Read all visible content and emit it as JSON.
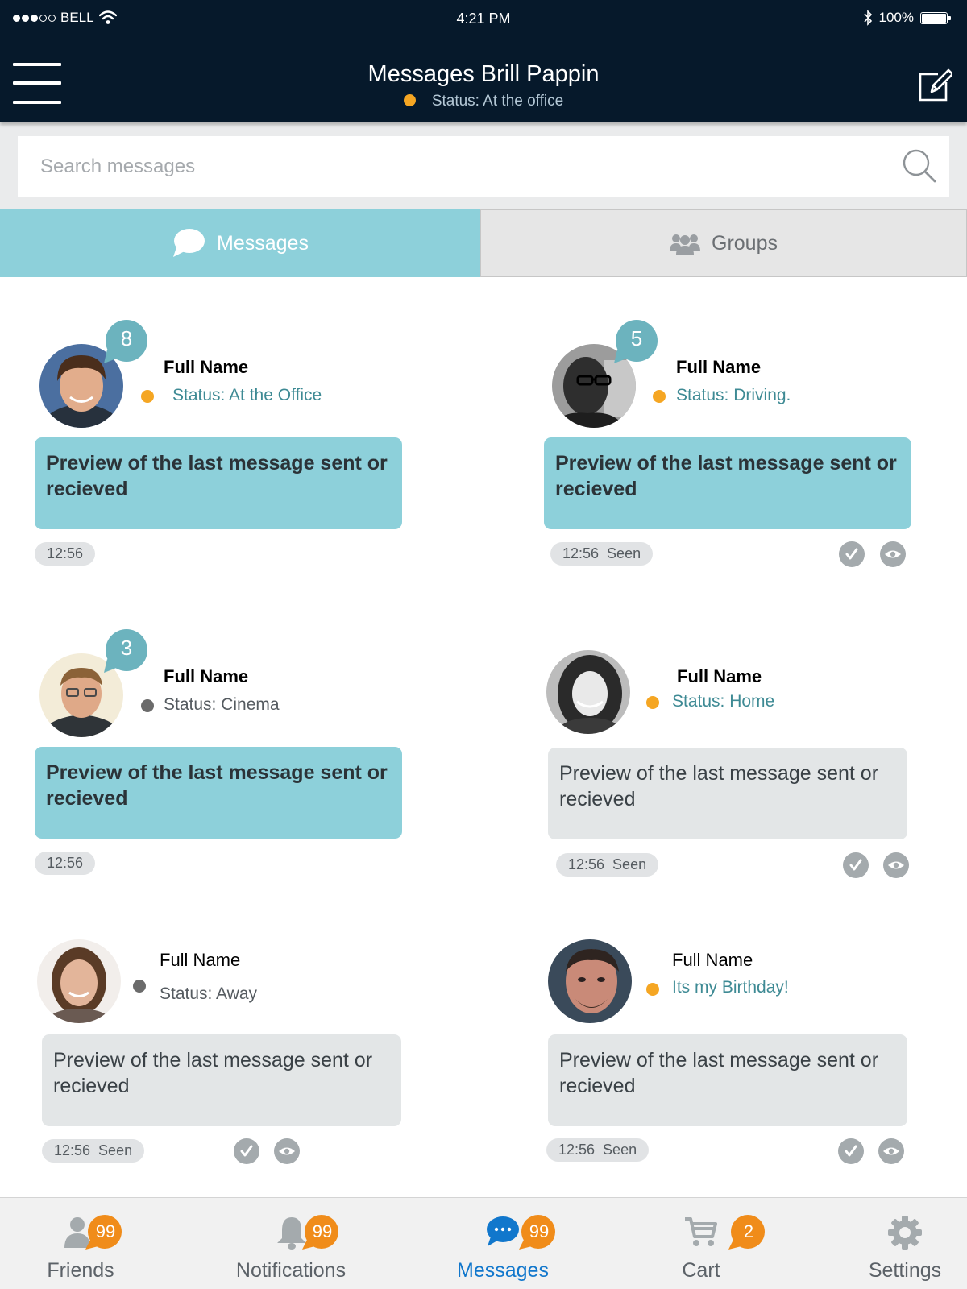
{
  "status_bar": {
    "carrier": "BELL",
    "time": "4:21 PM",
    "battery": "100%"
  },
  "header": {
    "title": "Messages Brill Pappin",
    "status": "Status: At the office"
  },
  "search": {
    "placeholder": "Search messages"
  },
  "tabs": [
    {
      "label": "Messages",
      "selected": true
    },
    {
      "label": "Groups",
      "selected": false
    }
  ],
  "colors": {
    "header_bg": "#06192b",
    "accent_teal": "#8dd0da",
    "status_available": "#f5a623",
    "status_away": "#6b6b6b",
    "active_nav": "#1177cc",
    "badge_orange": "#f08c1a"
  },
  "conversations": [
    {
      "name": "Full Name",
      "status": "Status: At the Office",
      "unread_count": "8",
      "preview": "Preview of the last message sent or recieved",
      "time": "12:56",
      "seen": ""
    },
    {
      "name": "Full Name",
      "status": "Status: Driving.",
      "unread_count": "5",
      "preview": "Preview of the last message sent or recieved",
      "time": "12:56",
      "seen": "Seen"
    },
    {
      "name": "Full Name",
      "status": "Status: Cinema",
      "unread_count": "3",
      "preview": "Preview of the last message sent or recieved",
      "time": "12:56",
      "seen": ""
    },
    {
      "name": "Full Name",
      "status": "Status: Home",
      "unread_count": "",
      "preview": "Preview of the last message sent or recieved",
      "time": "12:56",
      "seen": "Seen"
    },
    {
      "name": "Full Name",
      "status": "Status: Away",
      "unread_count": "",
      "preview": "Preview of the last message sent or recieved",
      "time": "12:56",
      "seen": "Seen"
    },
    {
      "name": "Full Name",
      "status": "Its my Birthday!",
      "unread_count": "",
      "preview": "Preview of the last message sent or recieved",
      "time": "12:56",
      "seen": "Seen"
    }
  ],
  "bottom_nav": [
    {
      "label": "Friends",
      "icon": "friends-icon",
      "badge": "99"
    },
    {
      "label": "Notifications",
      "icon": "bell-icon",
      "badge": "99"
    },
    {
      "label": "Messages",
      "icon": "chat-icon",
      "badge": "99",
      "active": true
    },
    {
      "label": "Cart",
      "icon": "cart-icon",
      "badge": "2"
    },
    {
      "label": "Settings",
      "icon": "gear-icon",
      "badge": ""
    }
  ]
}
